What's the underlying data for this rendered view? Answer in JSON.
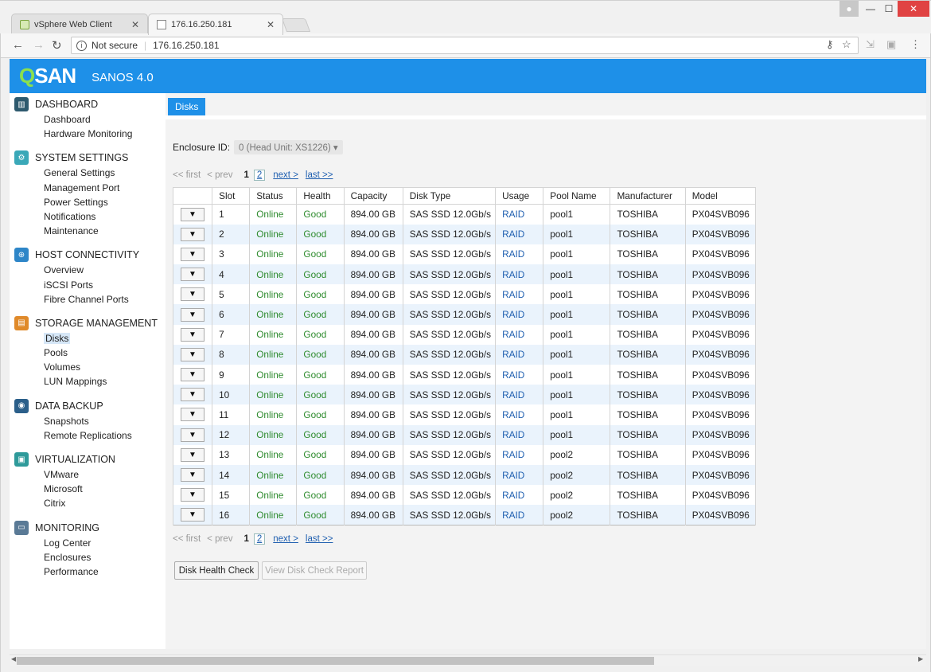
{
  "browser": {
    "tabs": [
      {
        "title": "vSphere Web Client"
      },
      {
        "title": "176.16.250.181"
      }
    ],
    "security": "Not secure",
    "url": "176.16.250.181"
  },
  "app": {
    "logo": "SAN",
    "logo_q": "Q",
    "product": "SANOS 4.0"
  },
  "sidebar": {
    "sections": [
      {
        "title": "DASHBOARD",
        "items": [
          "Dashboard",
          "Hardware Monitoring"
        ]
      },
      {
        "title": "SYSTEM SETTINGS",
        "items": [
          "General Settings",
          "Management Port",
          "Power Settings",
          "Notifications",
          "Maintenance"
        ]
      },
      {
        "title": "HOST CONNECTIVITY",
        "items": [
          "Overview",
          "iSCSI Ports",
          "Fibre Channel Ports"
        ]
      },
      {
        "title": "STORAGE MANAGEMENT",
        "items": [
          "Disks",
          "Pools",
          "Volumes",
          "LUN Mappings"
        ]
      },
      {
        "title": "DATA BACKUP",
        "items": [
          "Snapshots",
          "Remote Replications"
        ]
      },
      {
        "title": "VIRTUALIZATION",
        "items": [
          "VMware",
          "Microsoft",
          "Citrix"
        ]
      },
      {
        "title": "MONITORING",
        "items": [
          "Log Center",
          "Enclosures",
          "Performance"
        ]
      }
    ],
    "icon_colors": [
      "#2e5a6e",
      "#3aa8b8",
      "#2e86c8",
      "#e08a2a",
      "#2b5f8a",
      "#2e9a9a",
      "#5a7a96"
    ]
  },
  "main": {
    "tab": "Disks",
    "enclosure_label": "Enclosure ID:",
    "enclosure_value": "0 (Head Unit: XS1226)",
    "pager": {
      "first": "<< first",
      "prev": "< prev",
      "current": "1",
      "page2": "2",
      "next": "next >",
      "last": "last >>"
    },
    "columns": [
      "",
      "Slot",
      "Status",
      "Health",
      "Capacity",
      "Disk Type",
      "Usage",
      "Pool Name",
      "Manufacturer",
      "Model"
    ],
    "rows": [
      {
        "slot": "1",
        "status": "Online",
        "health": "Good",
        "capacity": "894.00 GB",
        "type": "SAS SSD 12.0Gb/s",
        "usage": "RAID",
        "pool": "pool1",
        "mfr": "TOSHIBA",
        "model": "PX04SVB096"
      },
      {
        "slot": "2",
        "status": "Online",
        "health": "Good",
        "capacity": "894.00 GB",
        "type": "SAS SSD 12.0Gb/s",
        "usage": "RAID",
        "pool": "pool1",
        "mfr": "TOSHIBA",
        "model": "PX04SVB096"
      },
      {
        "slot": "3",
        "status": "Online",
        "health": "Good",
        "capacity": "894.00 GB",
        "type": "SAS SSD 12.0Gb/s",
        "usage": "RAID",
        "pool": "pool1",
        "mfr": "TOSHIBA",
        "model": "PX04SVB096"
      },
      {
        "slot": "4",
        "status": "Online",
        "health": "Good",
        "capacity": "894.00 GB",
        "type": "SAS SSD 12.0Gb/s",
        "usage": "RAID",
        "pool": "pool1",
        "mfr": "TOSHIBA",
        "model": "PX04SVB096"
      },
      {
        "slot": "5",
        "status": "Online",
        "health": "Good",
        "capacity": "894.00 GB",
        "type": "SAS SSD 12.0Gb/s",
        "usage": "RAID",
        "pool": "pool1",
        "mfr": "TOSHIBA",
        "model": "PX04SVB096"
      },
      {
        "slot": "6",
        "status": "Online",
        "health": "Good",
        "capacity": "894.00 GB",
        "type": "SAS SSD 12.0Gb/s",
        "usage": "RAID",
        "pool": "pool1",
        "mfr": "TOSHIBA",
        "model": "PX04SVB096"
      },
      {
        "slot": "7",
        "status": "Online",
        "health": "Good",
        "capacity": "894.00 GB",
        "type": "SAS SSD 12.0Gb/s",
        "usage": "RAID",
        "pool": "pool1",
        "mfr": "TOSHIBA",
        "model": "PX04SVB096"
      },
      {
        "slot": "8",
        "status": "Online",
        "health": "Good",
        "capacity": "894.00 GB",
        "type": "SAS SSD 12.0Gb/s",
        "usage": "RAID",
        "pool": "pool1",
        "mfr": "TOSHIBA",
        "model": "PX04SVB096"
      },
      {
        "slot": "9",
        "status": "Online",
        "health": "Good",
        "capacity": "894.00 GB",
        "type": "SAS SSD 12.0Gb/s",
        "usage": "RAID",
        "pool": "pool1",
        "mfr": "TOSHIBA",
        "model": "PX04SVB096"
      },
      {
        "slot": "10",
        "status": "Online",
        "health": "Good",
        "capacity": "894.00 GB",
        "type": "SAS SSD 12.0Gb/s",
        "usage": "RAID",
        "pool": "pool1",
        "mfr": "TOSHIBA",
        "model": "PX04SVB096"
      },
      {
        "slot": "11",
        "status": "Online",
        "health": "Good",
        "capacity": "894.00 GB",
        "type": "SAS SSD 12.0Gb/s",
        "usage": "RAID",
        "pool": "pool1",
        "mfr": "TOSHIBA",
        "model": "PX04SVB096"
      },
      {
        "slot": "12",
        "status": "Online",
        "health": "Good",
        "capacity": "894.00 GB",
        "type": "SAS SSD 12.0Gb/s",
        "usage": "RAID",
        "pool": "pool1",
        "mfr": "TOSHIBA",
        "model": "PX04SVB096"
      },
      {
        "slot": "13",
        "status": "Online",
        "health": "Good",
        "capacity": "894.00 GB",
        "type": "SAS SSD 12.0Gb/s",
        "usage": "RAID",
        "pool": "pool2",
        "mfr": "TOSHIBA",
        "model": "PX04SVB096"
      },
      {
        "slot": "14",
        "status": "Online",
        "health": "Good",
        "capacity": "894.00 GB",
        "type": "SAS SSD 12.0Gb/s",
        "usage": "RAID",
        "pool": "pool2",
        "mfr": "TOSHIBA",
        "model": "PX04SVB096"
      },
      {
        "slot": "15",
        "status": "Online",
        "health": "Good",
        "capacity": "894.00 GB",
        "type": "SAS SSD 12.0Gb/s",
        "usage": "RAID",
        "pool": "pool2",
        "mfr": "TOSHIBA",
        "model": "PX04SVB096"
      },
      {
        "slot": "16",
        "status": "Online",
        "health": "Good",
        "capacity": "894.00 GB",
        "type": "SAS SSD 12.0Gb/s",
        "usage": "RAID",
        "pool": "pool2",
        "mfr": "TOSHIBA",
        "model": "PX04SVB096"
      }
    ],
    "row_button": "▼",
    "buttons": {
      "check": "Disk Health Check",
      "report": "View Disk Check Report"
    }
  },
  "colors": {
    "accent": "#1e90e8",
    "online": "#2e8b2e",
    "link": "#1f5fb0",
    "row_alt": "#eaf3fc"
  }
}
